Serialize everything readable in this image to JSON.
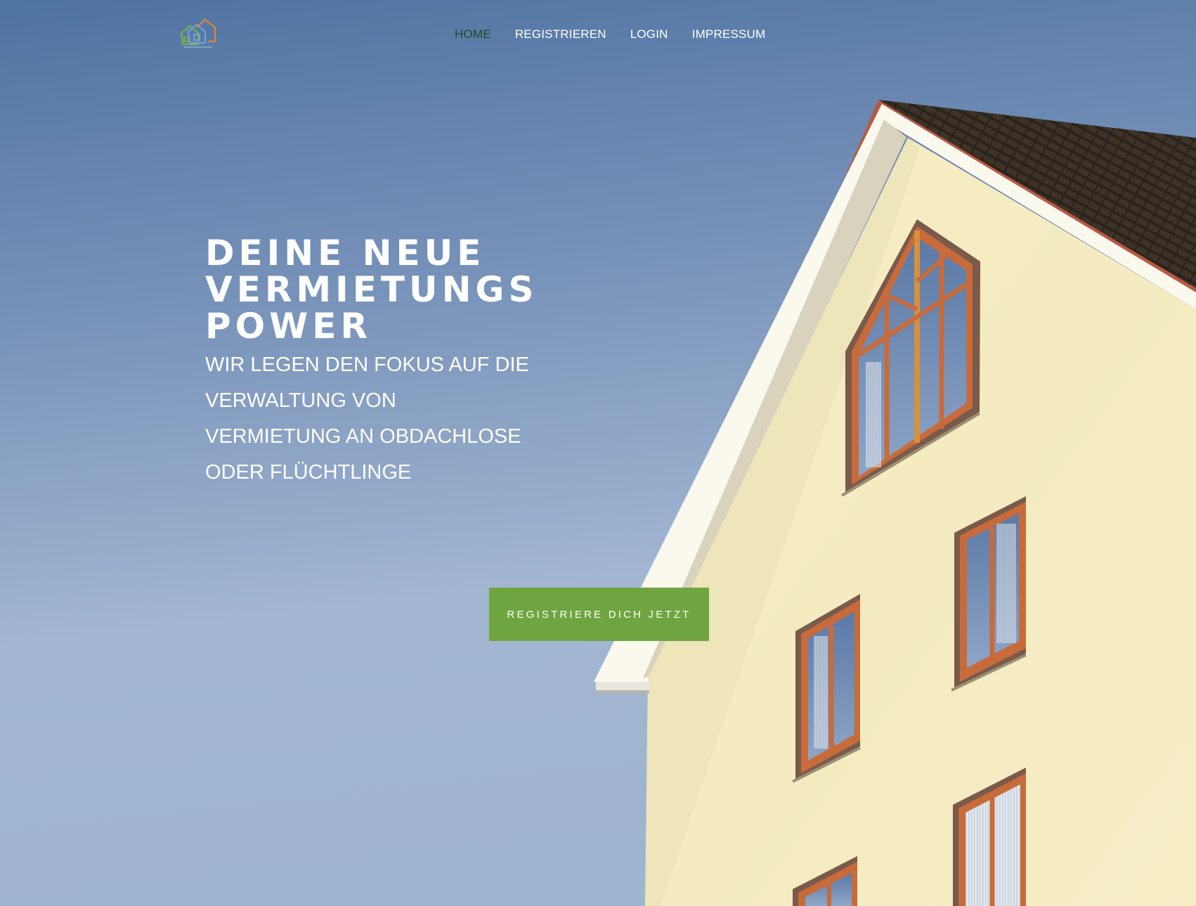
{
  "nav": {
    "items": [
      {
        "label": "HOME",
        "active": true
      },
      {
        "label": "REGISTRIEREN",
        "active": false
      },
      {
        "label": "LOGIN",
        "active": false
      },
      {
        "label": "IMPRESSUM",
        "active": false
      }
    ]
  },
  "hero": {
    "headline": [
      "DEINE NEUE",
      "VERMIETUNGS",
      "POWER"
    ],
    "subline": [
      "WIR LEGEN DEN FOKUS AUF DIE",
      "VERWALTUNG VON",
      "VERMIETUNG AN OBDACHLOSE",
      "ODER FLÜCHTLINGE"
    ],
    "cta_label": "REGISTRIERE DICH JETZT"
  },
  "colors": {
    "sky_top": "#4f74a2",
    "sky_bottom": "#a6bad3",
    "cta": "#6fa541",
    "nav_active": "#1f4a24",
    "facade": "#f6edc4"
  },
  "icons": {
    "logo": "house-logo-icon"
  }
}
